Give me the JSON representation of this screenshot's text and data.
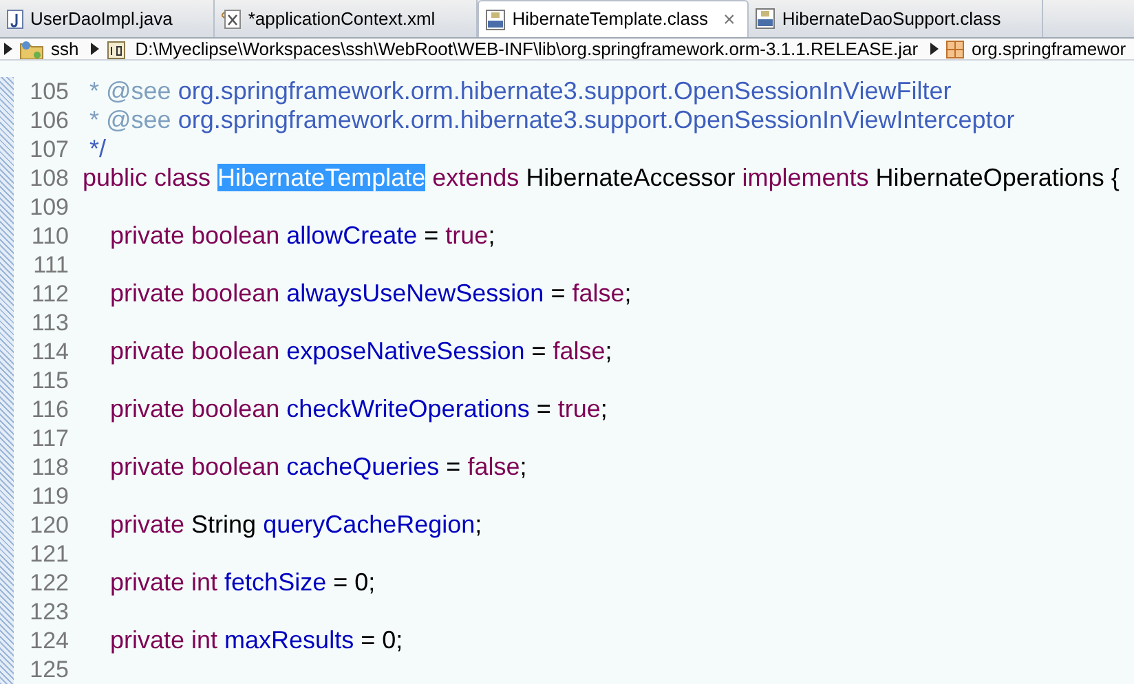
{
  "tabs": [
    {
      "label": "UserDaoImpl.java",
      "kind": "java",
      "selected": false,
      "dirty": false
    },
    {
      "label": "applicationContext.xml",
      "kind": "xml",
      "selected": false,
      "dirty": true
    },
    {
      "label": "HibernateTemplate.class",
      "kind": "class",
      "selected": true,
      "dirty": false
    },
    {
      "label": "HibernateDaoSupport.class",
      "kind": "class",
      "selected": false,
      "dirty": false
    }
  ],
  "dirty_mark": "*",
  "close_glyph": "×",
  "breadcrumb": [
    {
      "label": "ssh",
      "kind": "project"
    },
    {
      "label": "D:\\Myeclipse\\Workspaces\\ssh\\WebRoot\\WEB-INF\\lib\\org.springframework.orm-3.1.1.RELEASE.jar",
      "kind": "jar"
    },
    {
      "label": "org.springframewor",
      "kind": "package"
    }
  ],
  "code": [
    {
      "number": "105",
      "tokens": [
        {
          "text": " * @see ",
          "kind": "doc"
        },
        {
          "text": "org.springframework.orm.hibernate3.support.OpenSessionInViewFilter",
          "kind": "doclink"
        }
      ]
    },
    {
      "number": "106",
      "tokens": [
        {
          "text": " * @see ",
          "kind": "doc"
        },
        {
          "text": "org.springframework.orm.hibernate3.support.OpenSessionInViewInterceptor",
          "kind": "doclink"
        }
      ]
    },
    {
      "number": "107",
      "tokens": [
        {
          "text": " */",
          "kind": "doclink"
        }
      ]
    },
    {
      "number": "108",
      "tokens": [
        {
          "text": "public class ",
          "kind": "keyword"
        },
        {
          "text": "HibernateTemplate",
          "kind": "selection"
        },
        {
          "text": " extends ",
          "kind": "keyword"
        },
        {
          "text": "HibernateAccessor ",
          "kind": "plain"
        },
        {
          "text": "implements ",
          "kind": "keyword"
        },
        {
          "text": "HibernateOperations {",
          "kind": "plain"
        }
      ]
    },
    {
      "number": "109"
    },
    {
      "number": "110",
      "tokens": [
        {
          "text": "    private boolean ",
          "kind": "keyword"
        },
        {
          "text": "allowCreate",
          "kind": "field"
        },
        {
          "text": " = ",
          "kind": "plain"
        },
        {
          "text": "true",
          "kind": "keyword"
        },
        {
          "text": ";",
          "kind": "plain"
        }
      ]
    },
    {
      "number": "111"
    },
    {
      "number": "112",
      "tokens": [
        {
          "text": "    private boolean ",
          "kind": "keyword"
        },
        {
          "text": "alwaysUseNewSession",
          "kind": "field"
        },
        {
          "text": " = ",
          "kind": "plain"
        },
        {
          "text": "false",
          "kind": "keyword"
        },
        {
          "text": ";",
          "kind": "plain"
        }
      ]
    },
    {
      "number": "113"
    },
    {
      "number": "114",
      "tokens": [
        {
          "text": "    private boolean ",
          "kind": "keyword"
        },
        {
          "text": "exposeNativeSession",
          "kind": "field"
        },
        {
          "text": " = ",
          "kind": "plain"
        },
        {
          "text": "false",
          "kind": "keyword"
        },
        {
          "text": ";",
          "kind": "plain"
        }
      ]
    },
    {
      "number": "115"
    },
    {
      "number": "116",
      "tokens": [
        {
          "text": "    private boolean ",
          "kind": "keyword"
        },
        {
          "text": "checkWriteOperations",
          "kind": "field"
        },
        {
          "text": " = ",
          "kind": "plain"
        },
        {
          "text": "true",
          "kind": "keyword"
        },
        {
          "text": ";",
          "kind": "plain"
        }
      ]
    },
    {
      "number": "117"
    },
    {
      "number": "118",
      "tokens": [
        {
          "text": "    private boolean ",
          "kind": "keyword"
        },
        {
          "text": "cacheQueries",
          "kind": "field"
        },
        {
          "text": " = ",
          "kind": "plain"
        },
        {
          "text": "false",
          "kind": "keyword"
        },
        {
          "text": ";",
          "kind": "plain"
        }
      ]
    },
    {
      "number": "119"
    },
    {
      "number": "120",
      "tokens": [
        {
          "text": "    private ",
          "kind": "keyword"
        },
        {
          "text": "String ",
          "kind": "plain"
        },
        {
          "text": "queryCacheRegion",
          "kind": "field"
        },
        {
          "text": ";",
          "kind": "plain"
        }
      ]
    },
    {
      "number": "121"
    },
    {
      "number": "122",
      "tokens": [
        {
          "text": "    private int ",
          "kind": "keyword"
        },
        {
          "text": "fetchSize",
          "kind": "field"
        },
        {
          "text": " = 0;",
          "kind": "plain"
        }
      ]
    },
    {
      "number": "123"
    },
    {
      "number": "124",
      "tokens": [
        {
          "text": "    private int ",
          "kind": "keyword"
        },
        {
          "text": "maxResults",
          "kind": "field"
        },
        {
          "text": " = 0;",
          "kind": "plain"
        }
      ]
    },
    {
      "number": "125"
    }
  ]
}
